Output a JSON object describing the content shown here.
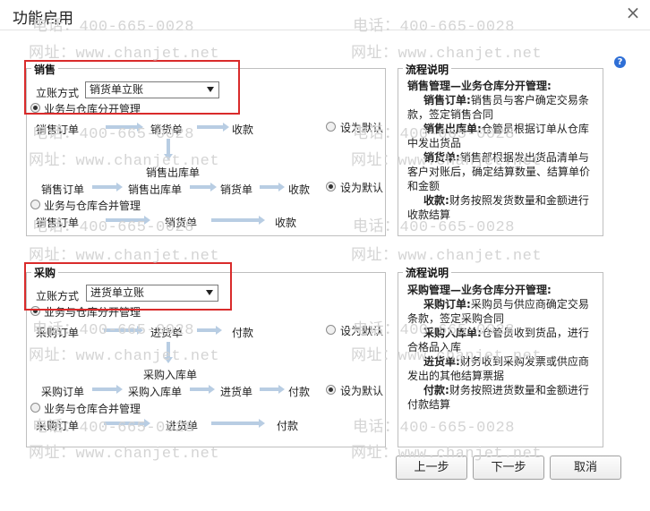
{
  "dialog": {
    "title": "功能启用",
    "close_glyph": "×",
    "help_glyph": "?"
  },
  "watermark": {
    "phone": "电话：400-665-0028",
    "site": "网址：www.chanjet.net"
  },
  "sales": {
    "section_label": "销售",
    "method_label": "立账方式",
    "method_value": "销货单立账",
    "opt_separate": "业务与仓库分开管理",
    "opt_merged": "业务与仓库合并管理",
    "set_default": "设为默认",
    "flow1": [
      "销售订单",
      "销货单",
      "收款"
    ],
    "flow1_branch": "销售出库单",
    "flow2": [
      "销售订单",
      "销售出库单",
      "销货单",
      "收款"
    ],
    "flow3": [
      "销售订单",
      "销货单",
      "收款"
    ],
    "desc_title": "流程说明",
    "desc_head": "销售管理—业务仓库分开管理:",
    "desc_items": [
      {
        "term": "销售订单:",
        "text": "销售员与客户确定交易条款，签定销售合同"
      },
      {
        "term": "销售出库单:",
        "text": "仓管员根据订单从仓库中发出货品"
      },
      {
        "term": "销货单:",
        "text": "销售部根据发出货品清单与客户对账后，确定结算数量、结算单价和金额"
      },
      {
        "term": "收款:",
        "text": "财务按照发货数量和金额进行收款结算"
      }
    ]
  },
  "purchase": {
    "section_label": "采购",
    "method_label": "立账方式",
    "method_value": "进货单立账",
    "opt_separate": "业务与仓库分开管理",
    "opt_merged": "业务与仓库合并管理",
    "set_default": "设为默认",
    "flow1": [
      "采购订单",
      "进货单",
      "付款"
    ],
    "flow1_branch": "采购入库单",
    "flow2": [
      "采购订单",
      "采购入库单",
      "进货单",
      "付款"
    ],
    "flow3": [
      "采购订单",
      "进货单",
      "付款"
    ],
    "desc_title": "流程说明",
    "desc_head": "采购管理—业务仓库分开管理:",
    "desc_items": [
      {
        "term": "采购订单:",
        "text": "采购员与供应商确定交易条款，签定采购合同"
      },
      {
        "term": "采购入库单:",
        "text": "仓管员收到货品，进行合格品入库"
      },
      {
        "term": "进货单:",
        "text": "财务收到采购发票或供应商发出的其他结算票据"
      },
      {
        "term": "付款:",
        "text": "财务按照进货数量和金额进行付款结算"
      }
    ]
  },
  "buttons": {
    "prev": "上一步",
    "next": "下一步",
    "cancel": "取消"
  }
}
